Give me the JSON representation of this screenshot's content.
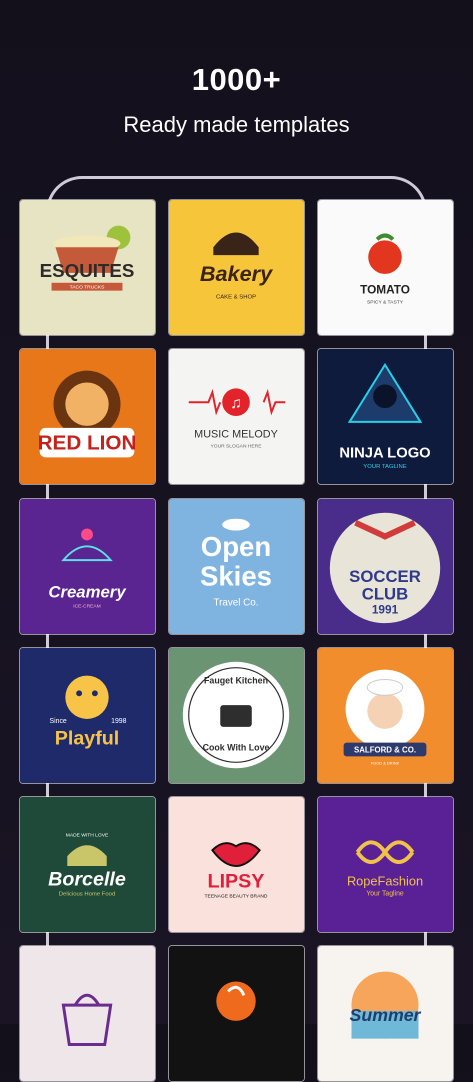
{
  "header": {
    "title": "1000+",
    "subtitle": "Ready made templates"
  },
  "templates": [
    {
      "name": "ESQUITES",
      "tagline": "TACO TRUCKS"
    },
    {
      "name": "Bakery",
      "tagline": "CAKE & SHOP"
    },
    {
      "name": "TOMATO",
      "tagline": "SPICY & TASTY"
    },
    {
      "name": "RED LION"
    },
    {
      "name": "MUSIC MELODY",
      "tagline": "YOUR SLOGAN HERE"
    },
    {
      "name": "NINJA LOGO",
      "tagline": "YOUR TAGLINE"
    },
    {
      "name": "Creamery",
      "tagline": "ICE-CREAM"
    },
    {
      "name1": "Open",
      "name2": "Skies",
      "tagline": "Travel Co."
    },
    {
      "name1": "SOCCER",
      "name2": "CLUB",
      "year": "1991"
    },
    {
      "since": "Since",
      "year": "1998",
      "name": "Playful"
    },
    {
      "top": "Fauget Kitchen",
      "bottom": "Cook With Love"
    },
    {
      "name": "SALFORD & CO.",
      "tagline": "FOOD & DRINK"
    },
    {
      "top": "MADE WITH LOVE",
      "name": "Borcelle",
      "tagline": "Delicious Home Food"
    },
    {
      "name": "LIPSY",
      "tagline": "TEENAGE BEAUTY BRAND"
    },
    {
      "name": "RopeFashion",
      "tagline": "Your Tagline"
    },
    {
      "name": ""
    },
    {
      "name": ""
    },
    {
      "name": "Summer"
    }
  ]
}
